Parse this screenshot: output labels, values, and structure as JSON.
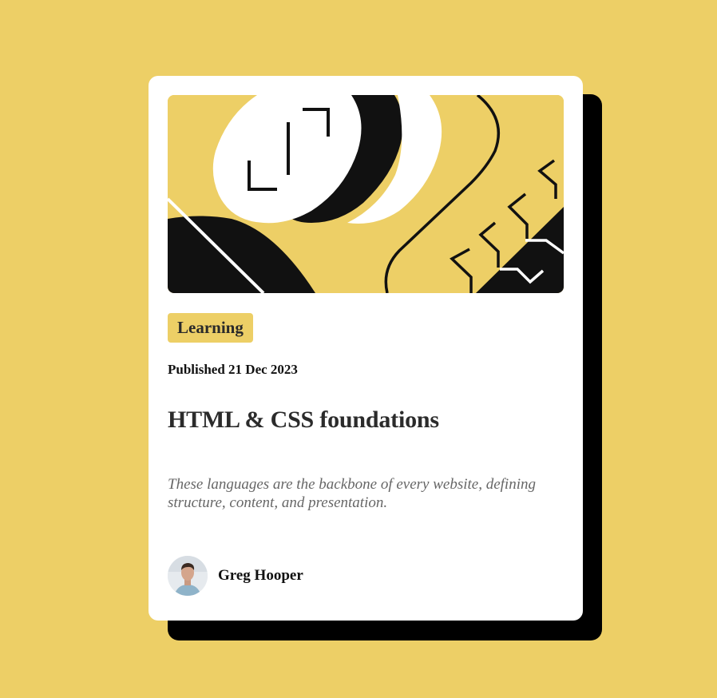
{
  "colors": {
    "page_background": "#EDCF66",
    "card_background": "#FFFFFF",
    "card_shadow": "#000000",
    "tag_background": "#EDCF66",
    "heading_text": "#2B2B2B",
    "body_text": "#666666"
  },
  "card": {
    "hero_image": "abstract-illustration",
    "tag": "Learning",
    "published": "Published 21 Dec 2023",
    "title": "HTML & CSS foundations",
    "description": "These languages are the backbone of every website, defining structure, content, and presentation.",
    "author": {
      "name": "Greg Hooper",
      "avatar": "author-avatar-photo"
    }
  }
}
